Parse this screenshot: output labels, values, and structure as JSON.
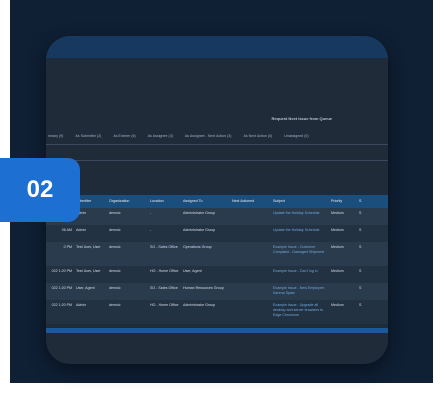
{
  "badge": {
    "text": "02"
  },
  "queue": {
    "title": "Request Next Issue from Queue"
  },
  "filters": [
    "nmary (9)",
    "As Submitter (2)",
    "As Enterer (6)",
    "As Assignee (3)",
    "As Assignee - Next Action (3)",
    "As Next Action (0)",
    "Unassigned (0)"
  ],
  "columns": [
    "s",
    "Submitter",
    "Organization",
    "Location",
    "Assigned To",
    "Next Actioned",
    "Subject",
    "Priority",
    "S"
  ],
  "rows": [
    [
      "06 AM",
      "Admin",
      "demolc",
      "-",
      "Administrator Group",
      "",
      "Update the Holiday Schedule",
      "Medium",
      "S"
    ],
    [
      "06 AM",
      "Admin",
      "demolc",
      "-",
      "Administrator Group",
      "",
      "Update the Holiday Schedule",
      "Medium",
      "S"
    ],
    [
      "0 PM",
      "Test User, User",
      "demolc",
      "SO - Sales Office",
      "Operations Group",
      "",
      "Example Issue - Customer Complaint - Damaged Shipment",
      "Medium",
      "S"
    ],
    [
      "022 1:20 PM",
      "Test User, User",
      "demolc",
      "HO - Home Office",
      "User, Agent",
      "",
      "Example Issue - Can't log in",
      "Medium",
      "S"
    ],
    [
      "022 1:20 PM",
      "User, Agent",
      "demolc",
      "SO - Sales Office",
      "Human Resources Group",
      "",
      "Example Issue - New Employee: Karena Spatz",
      "",
      "S"
    ],
    [
      "022 1:20 PM",
      "Admin",
      "demolc",
      "HO - Home Office",
      "Administrator Group",
      "",
      "Example Issue - Upgrade all desktop and server browsers to Edge Chromium",
      "Medium",
      "S"
    ]
  ],
  "colors": {
    "background": "#0f1f34",
    "card": "#1f2b39",
    "header_bar": "#1a4e7d",
    "badge": "#1d6fd1",
    "subject_link": "#6fa8dc"
  }
}
